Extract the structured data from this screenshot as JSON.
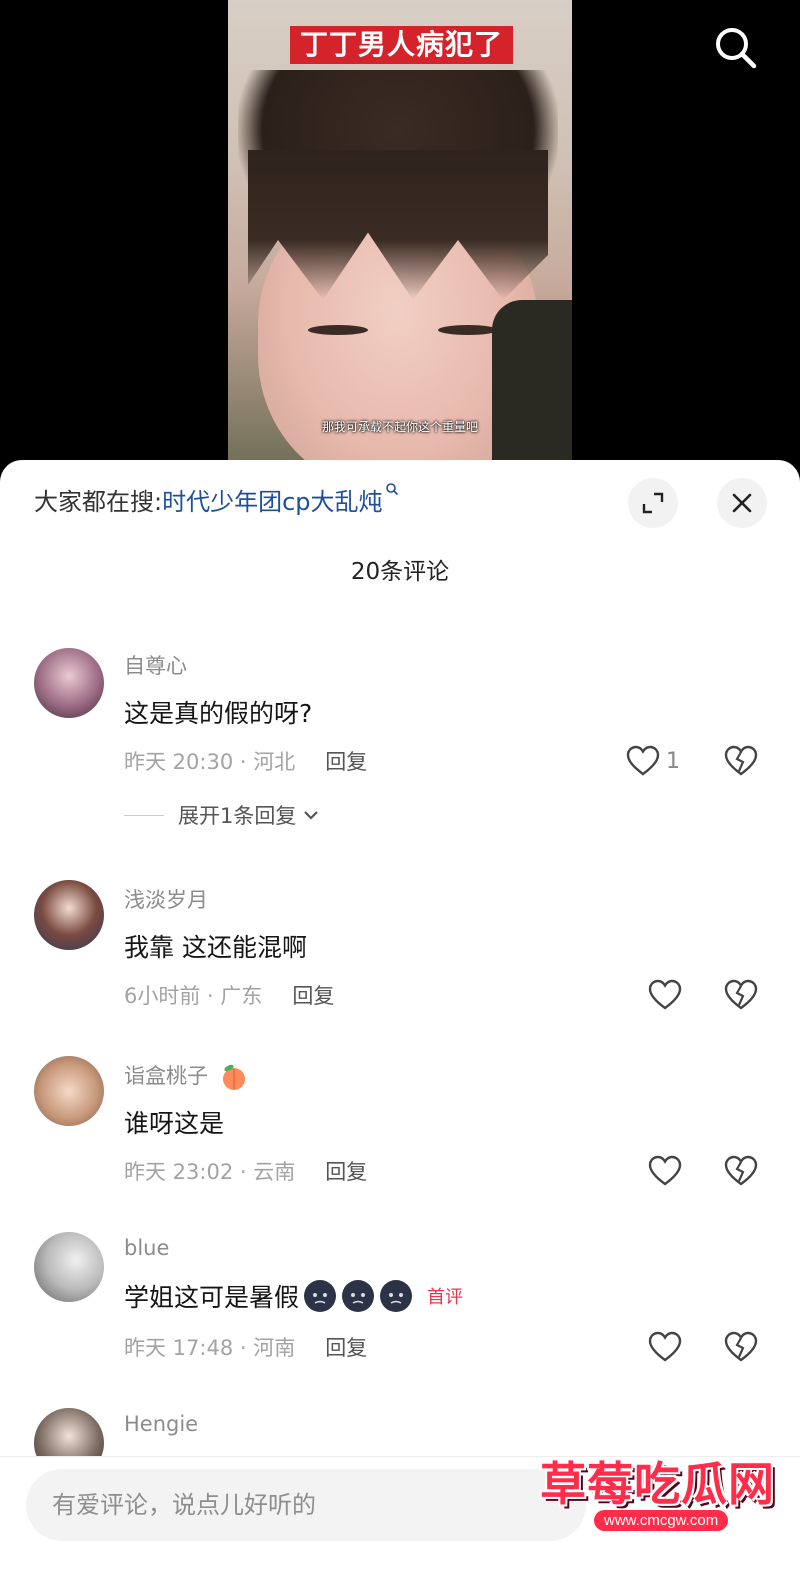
{
  "video": {
    "title": "丁丁男人病犯了",
    "subtitle": "那我可承载不起你这个重量吧"
  },
  "sheet": {
    "hot_search_label": "大家都在搜:",
    "hot_search_term": "时代少年团cp大乱炖",
    "comment_count": "20条评论"
  },
  "comments": [
    {
      "username": "自尊心",
      "text": "这是真的假的呀?",
      "time_location": "昨天 20:30 · 河北",
      "reply": "回复",
      "likes": "1",
      "expand": "展开1条回复"
    },
    {
      "username": "浅淡岁月",
      "text": "我靠 这还能混啊",
      "time_location": "6小时前 · 广东",
      "reply": "回复",
      "likes": ""
    },
    {
      "username": "诣盒桃子",
      "text": "谁呀这是",
      "time_location": "昨天 23:02 · 云南",
      "reply": "回复",
      "likes": ""
    },
    {
      "username": "blue",
      "text": "学姐这可是暑假",
      "badge": "首评",
      "time_location": "昨天 17:48 · 河南",
      "reply": "回复",
      "likes": ""
    },
    {
      "username": "Hengie"
    }
  ],
  "input": {
    "placeholder": "有爱评论，说点儿好听的"
  },
  "watermark": {
    "text": "草莓吃瓜网",
    "url": "www.cmcgw.com"
  },
  "colors": {
    "accent_link": "#1e4f9c",
    "badge_red": "#e8364d",
    "video_title_bg": "#d4232b"
  },
  "icons": [
    "search-icon",
    "expand-icon",
    "close-icon",
    "heart-icon",
    "broken-heart-icon",
    "chevron-down-icon",
    "peach-emoji",
    "sleepy-face-emoji"
  ]
}
